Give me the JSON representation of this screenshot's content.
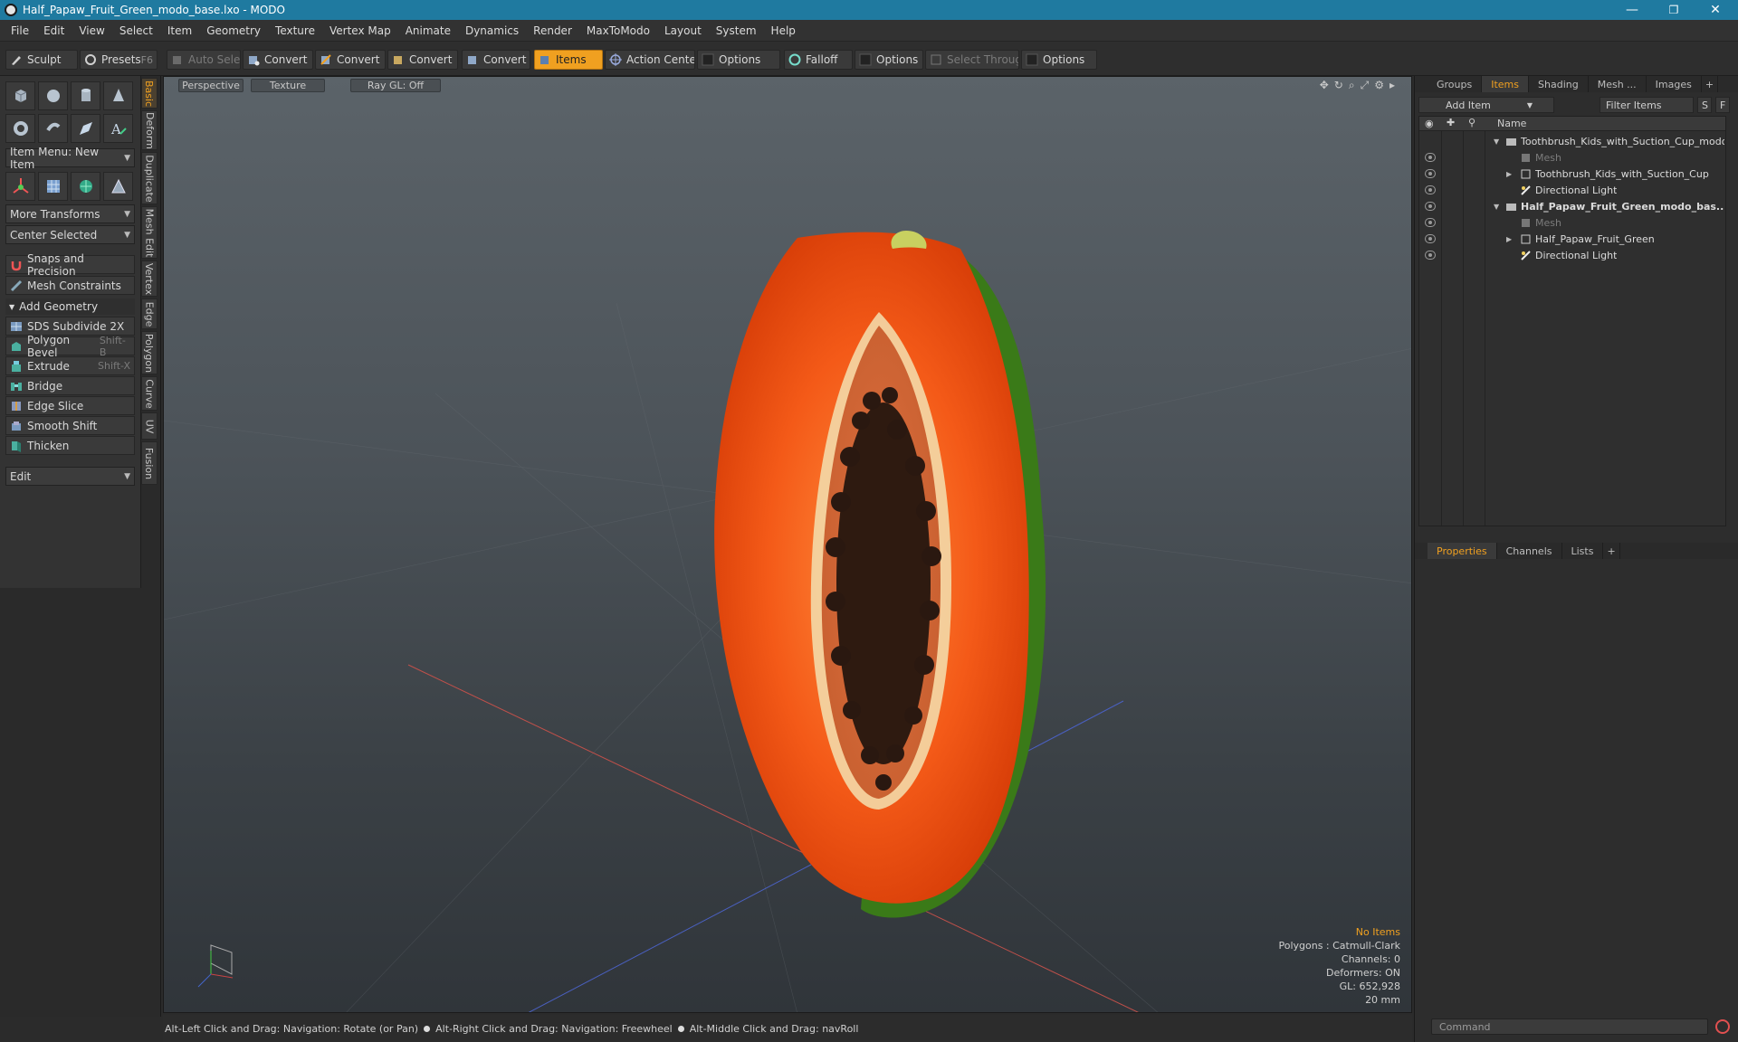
{
  "window": {
    "title": "Half_Papaw_Fruit_Green_modo_base.lxo - MODO",
    "minimize": "—",
    "restore": "❐",
    "close": "✕"
  },
  "menu": [
    "File",
    "Edit",
    "View",
    "Select",
    "Item",
    "Geometry",
    "Texture",
    "Vertex Map",
    "Animate",
    "Dynamics",
    "Render",
    "MaxToModo",
    "Layout",
    "System",
    "Help"
  ],
  "toolbar": {
    "sculpt": "Sculpt",
    "presets": "Presets",
    "presets_key": "F6",
    "auto_select": "Auto Select",
    "convert1": "Convert",
    "convert2": "Convert",
    "convert3": "Convert",
    "convert4": "Convert",
    "items": "Items",
    "action_center": "Action Center",
    "options1": "Options",
    "falloff": "Falloff",
    "options2": "Options",
    "select_through": "Select Through",
    "options3": "Options"
  },
  "left": {
    "item_menu": "Item Menu: New Item",
    "more_transforms": "More Transforms",
    "center_selected": "Center Selected",
    "snaps": "Snaps and Precision",
    "mesh_constraints": "Mesh Constraints",
    "add_geometry": "Add Geometry",
    "tools": [
      {
        "label": "SDS Subdivide 2X",
        "key": ""
      },
      {
        "label": "Polygon Bevel",
        "key": "Shift-B"
      },
      {
        "label": "Extrude",
        "key": "Shift-X"
      },
      {
        "label": "Bridge",
        "key": ""
      },
      {
        "label": "Edge Slice",
        "key": ""
      },
      {
        "label": "Smooth Shift",
        "key": ""
      },
      {
        "label": "Thicken",
        "key": ""
      }
    ],
    "edit": "Edit",
    "vtabs": [
      "Basic",
      "Deform",
      "Duplicate",
      "Mesh Edit",
      "Vertex",
      "Edge",
      "Polygon",
      "Curve",
      "UV",
      "Fusion"
    ]
  },
  "viewport": {
    "perspective": "Perspective",
    "texture": "Texture",
    "raygl": "Ray GL: Off",
    "stats": {
      "no_items": "No Items",
      "polygons": "Polygons : Catmull-Clark",
      "channels": "Channels: 0",
      "deformers": "Deformers: ON",
      "gl": "GL: 652,928",
      "scale": "20 mm"
    }
  },
  "status": {
    "hint1": "Alt-Left Click and Drag: Navigation: Rotate (or Pan)",
    "hint2": "Alt-Right Click and Drag: Navigation: Freewheel",
    "hint3": "Alt-Middle Click and Drag: navRoll"
  },
  "right": {
    "tabs": [
      "Groups",
      "Items",
      "Shading",
      "Mesh ...",
      "Images",
      "+"
    ],
    "add_item": "Add Item",
    "filter_items": "Filter Items",
    "s_btn": "S",
    "f_btn": "F",
    "name_col": "Name",
    "tree": [
      {
        "label": "Toothbrush_Kids_with_Suction_Cup_modo ..."
      },
      {
        "label": "Mesh"
      },
      {
        "label": "Toothbrush_Kids_with_Suction_Cup"
      },
      {
        "label": "Directional Light"
      },
      {
        "label": "Half_Papaw_Fruit_Green_modo_bas..."
      },
      {
        "label": "Mesh"
      },
      {
        "label": "Half_Papaw_Fruit_Green"
      },
      {
        "label": "Directional Light"
      }
    ],
    "prop_tabs": [
      "Properties",
      "Channels",
      "Lists",
      "+"
    ],
    "command_placeholder": "Command"
  },
  "colors": {
    "accent": "#f0a020",
    "titlebar": "#1f7aa0"
  }
}
